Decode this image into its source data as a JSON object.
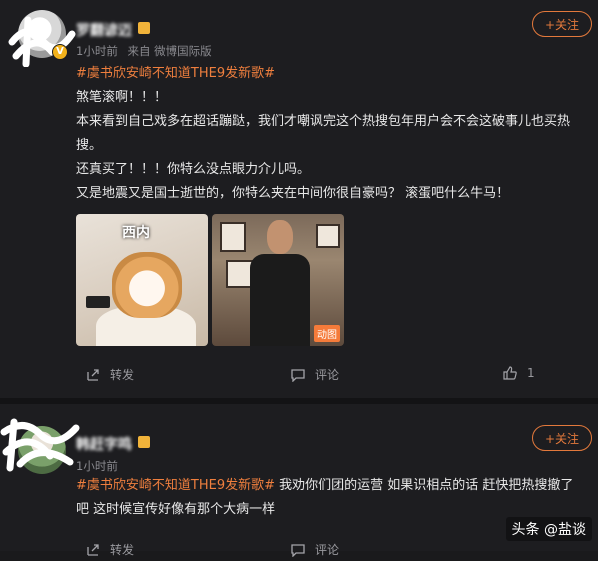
{
  "posts": [
    {
      "username": "罗翻谚迈",
      "time": "1小时前",
      "source": "来自 微博国际版",
      "follow_label": "+关注",
      "topic": "#虞书欣安崎不知道THE9发新歌#",
      "lines": [
        "煞笔滚啊！！！",
        "本来看到自己戏多在超话蹦跶，我们才嘲讽完这个热搜包年用户会不会这破事儿也买热",
        "搜。",
        "还真买了！！！你特么没点眼力介儿吗。",
        "又是地震又是国士逝世的，你特么夹在中间你很自豪吗？ 滚蛋吧什么牛马！"
      ],
      "images": [
        {
          "caption": "西内",
          "icon": "cat-meme-image"
        },
        {
          "badge": "动图",
          "icon": "person-gif-image"
        }
      ],
      "actions": {
        "repost": "转发",
        "comment": "评论",
        "like_count": "1"
      }
    },
    {
      "username": "韩赶字鸣",
      "time": "1小时前",
      "follow_label": "+关注",
      "topic": "#虞书欣安崎不知道THE9发新歌#",
      "text_after_topic": " 我劝你们团的运营 如果识相点的话 赶快把热搜撤了",
      "line2": "吧 这时候宣传好像有那个大病一样",
      "actions": {
        "repost": "转发",
        "comment": "评论"
      }
    }
  ],
  "watermark": "头条 @盐谈",
  "colors": {
    "accent": "#ef7f3e",
    "background": "#1d1d20",
    "badge": "#f3b21b"
  }
}
